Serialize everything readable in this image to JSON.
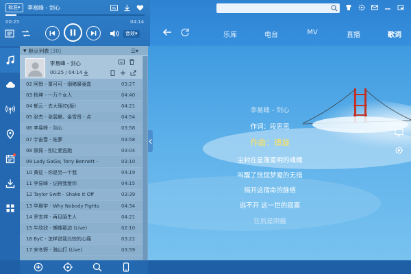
{
  "player": {
    "quality_badge": "标准▾",
    "now_playing": "李易峰 - 剑心",
    "progress": 0.08,
    "time_elapsed": "00:25",
    "time_total": "04:14",
    "sound_effect": "音效▾"
  },
  "header": {
    "tabs": [
      "乐库",
      "电台",
      "MV",
      "直播",
      "歌词"
    ],
    "active_tab": "歌词"
  },
  "sidebar": {
    "items": [
      "music-note-icon",
      "cloud-icon",
      "radio-icon",
      "location-icon",
      "calendar-icon",
      "download-icon",
      "apps-icon"
    ]
  },
  "playlist": {
    "title": "默认列表",
    "count": "[30]",
    "more": "☰▾",
    "current": {
      "title": "李易峰 - 剑心",
      "time": "00:25 / 04:14"
    },
    "rows": [
      {
        "name": "02 阿悄 - 童可可 - 烟猪最强盒",
        "dur": "03:27"
      },
      {
        "name": "03 杨坤 - 一万个女人",
        "dur": "04:40"
      },
      {
        "name": "04 郁云 - 去大理(DJ版)",
        "dur": "04:21"
      },
      {
        "name": "05 张杰 - 张碧晨、金雪贤 - 点",
        "dur": "04:54"
      },
      {
        "name": "06 李易峰 - 剑心",
        "dur": "03:58"
      },
      {
        "name": "07 宇宙春 - 娃萝",
        "dur": "03:58"
      },
      {
        "name": "08 佩佩 - 别让爱逃跑",
        "dur": "03:04"
      },
      {
        "name": "09 Lady GaGa; Tony Bennett -",
        "dur": "03:10"
      },
      {
        "name": "10 黄征 - 你是另一个我",
        "dur": "04:19"
      },
      {
        "name": "11 李易峰 - 记得我爱你",
        "dur": "04:15"
      },
      {
        "name": "12 Taylor Swift - Shake It Off",
        "dur": "03:39"
      },
      {
        "name": "13 华晨宇 - Why Nobody Fights",
        "dur": "04:34"
      },
      {
        "name": "14 罗志祥 - 再见陌生人",
        "dur": "04:21"
      },
      {
        "name": "15 牛欣欣 - 懒蝶那边 (Live)",
        "dur": "02:10"
      },
      {
        "name": "16 ByC - 怎样说我比较的心痛",
        "dur": "03:22"
      },
      {
        "name": "17 宋冬野 - 骑山打 (Live)",
        "dur": "03:59"
      }
    ]
  },
  "lyrics": {
    "lines": [
      {
        "text": "李易峰 - 剑心",
        "style": "dim"
      },
      {
        "text": "作词：段思思",
        "style": "normal"
      },
      {
        "text": "作曲：谭旋",
        "style": "highlight"
      },
      {
        "text": "尘封在星蓬重明的魂魄",
        "style": "normal"
      },
      {
        "text": "叫醒了恍惚梦魇的无措",
        "style": "normal"
      },
      {
        "text": "揭开这宿命的脉络",
        "style": "normal"
      },
      {
        "text": "逃不开 这一世的寂寞",
        "style": "normal"
      },
      {
        "text": "往后是阴霾",
        "style": "dim"
      }
    ]
  }
}
